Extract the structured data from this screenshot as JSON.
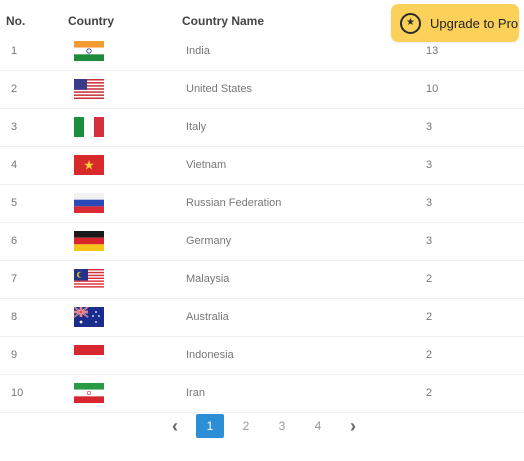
{
  "table": {
    "headers": {
      "no": "No.",
      "country": "Country",
      "name": "Country Name"
    },
    "rows": [
      {
        "no": "1",
        "flag": "india-flag-icon",
        "name": "India",
        "count": "13"
      },
      {
        "no": "2",
        "flag": "usa-flag-icon",
        "name": "United States",
        "count": "10"
      },
      {
        "no": "3",
        "flag": "italy-flag-icon",
        "name": "Italy",
        "count": "3"
      },
      {
        "no": "4",
        "flag": "vietnam-flag-icon",
        "name": "Vietnam",
        "count": "3"
      },
      {
        "no": "5",
        "flag": "russia-flag-icon",
        "name": "Russian Federation",
        "count": "3"
      },
      {
        "no": "6",
        "flag": "germany-flag-icon",
        "name": "Germany",
        "count": "3"
      },
      {
        "no": "7",
        "flag": "malaysia-flag-icon",
        "name": "Malaysia",
        "count": "2"
      },
      {
        "no": "8",
        "flag": "australia-flag-icon",
        "name": "Australia",
        "count": "2"
      },
      {
        "no": "9",
        "flag": "indonesia-flag-icon",
        "name": "Indonesia",
        "count": "2"
      },
      {
        "no": "10",
        "flag": "iran-flag-icon",
        "name": "Iran",
        "count": "2"
      }
    ]
  },
  "upgrade": {
    "label": "Upgrade to Pro",
    "icon": "star-icon",
    "color": "#fcd15a"
  },
  "pagination": {
    "prev_icon": "chevron-left-icon",
    "next_icon": "chevron-right-icon",
    "pages": [
      "1",
      "2",
      "3",
      "4"
    ],
    "active_page": "1",
    "active_color": "#2d8ed8"
  }
}
